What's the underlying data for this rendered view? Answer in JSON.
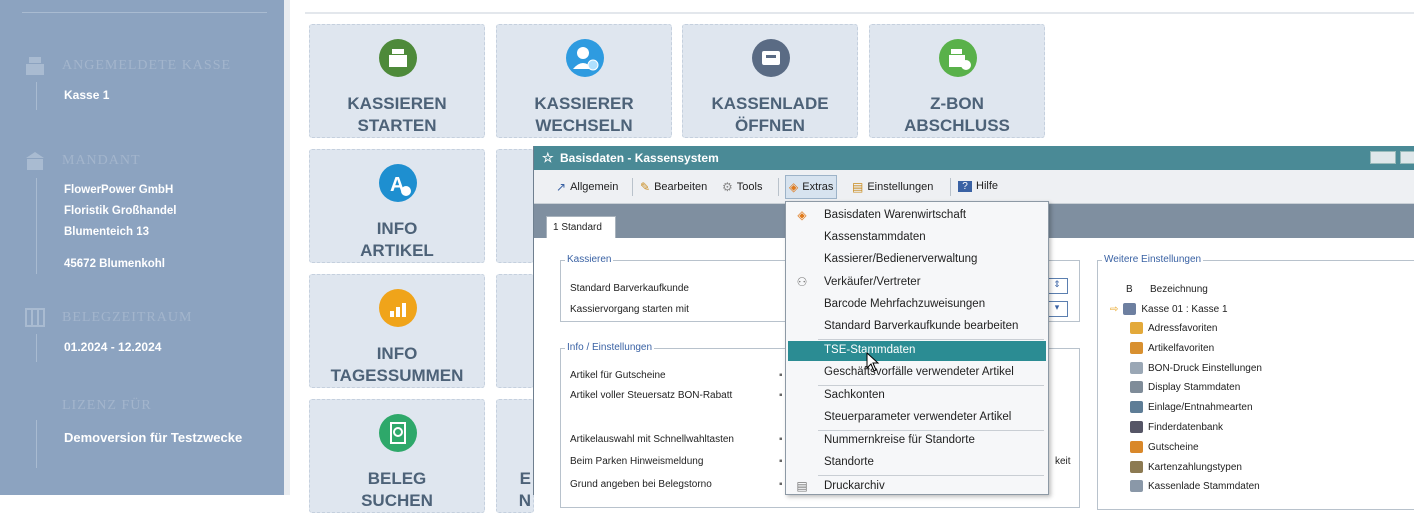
{
  "sidebar": {
    "register": {
      "heading": "ANGEMELDETE KASSE",
      "value": "Kasse 1",
      "icon": "register-icon"
    },
    "client": {
      "heading": "MANDANT",
      "line1": "FlowerPower GmbH",
      "line2": "Floristik Großhandel",
      "line3": "Blumenteich 13",
      "line4": "45672 Blumenkohl",
      "icon": "store-icon"
    },
    "period": {
      "heading": "BELEGZEITRAUM",
      "value": "01.2024 - 12.2024",
      "icon": "calendar-icon"
    },
    "license": {
      "heading": "LIZENZ FÜR",
      "value": "Demoversion für Testzwecke"
    }
  },
  "tiles": [
    {
      "line1": "KASSIEREN",
      "line2": "STARTEN",
      "color": "#4e8a3a"
    },
    {
      "line1": "KASSIERER",
      "line2": "WECHSELN",
      "color": "#2e9be0"
    },
    {
      "line1": "KASSENLADE",
      "line2": "ÖFFNEN",
      "color": "#5a6b84"
    },
    {
      "line1": "Z-BON",
      "line2": "ABSCHLUSS",
      "color": "#59b14a"
    },
    {
      "line1": "INFO",
      "line2": "ARTIKEL",
      "color": "#1e8fd0"
    },
    {
      "line1": "INFO",
      "line2": "TAGESSUMMEN",
      "color": "#f0a41a"
    },
    {
      "line1": "BELEG",
      "line2": "SUCHEN",
      "color": "#2ea86a"
    },
    {
      "line1": "E",
      "line2": "N",
      "color": "#dfe6ef"
    }
  ],
  "window": {
    "title": "Basisdaten - Kassensystem",
    "menu": {
      "allgemein": "Allgemein",
      "bearbeiten": "Bearbeiten",
      "tools": "Tools",
      "extras": "Extras",
      "einstellungen": "Einstellungen",
      "hilfe": "Hilfe"
    },
    "tab": "1 Standard",
    "kassieren": {
      "label": "Kassieren",
      "row1": "Standard Barverkaufkunde",
      "row2": "Kassiervorgang starten mit"
    },
    "info": {
      "label": "Info / Einstellungen",
      "rows": [
        "Artikel für Gutscheine",
        "Artikel voller Steuersatz BON-Rabatt",
        "Artikelauswahl mit Schnellwahltasten",
        "Beim Parken Hinweismeldung",
        "Grund angeben bei Belegstorno"
      ],
      "trailing": "keit"
    },
    "weitere": {
      "label": "Weitere Einstellungen",
      "col_b": "B",
      "col_name": "Bezeichnung",
      "items": [
        "Kasse 01 : Kasse 1",
        "Adressfavoriten",
        "Artikelfavoriten",
        "BON-Druck Einstellungen",
        "Display Stammdaten",
        "Einlage/Entnahmearten",
        "Finderdatenbank",
        "Gutscheine",
        "Kartenzahlungstypen",
        "Kassenlade Stammdaten"
      ]
    }
  },
  "extras_menu": [
    "Basisdaten Warenwirtschaft",
    "Kassenstammdaten",
    "Kassierer/Bedienerverwaltung",
    "Verkäufer/Vertreter",
    "Barcode Mehrfachzuweisungen",
    "Standard Barverkaufkunde bearbeiten",
    "TSE-Stammdaten",
    "Geschäftsvorfälle verwendeter Artikel",
    "Sachkonten",
    "Steuerparameter verwendeter Artikel",
    "Nummernkreise für Standorte",
    "Standorte",
    "Druckarchiv"
  ],
  "colors": {
    "sidebar": "#8ca3c0",
    "titlebar": "#4a8a96",
    "highlight": "#2b8c93"
  }
}
